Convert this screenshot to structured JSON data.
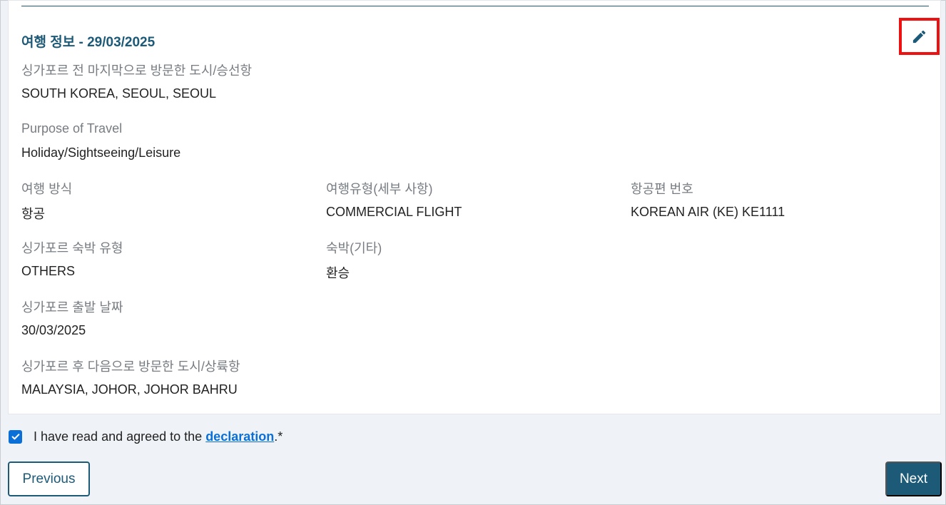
{
  "travel": {
    "title": "여행 정보 - 29/03/2025",
    "edit_icon": "pencil-icon",
    "last_city_label": "싱가포르 전 마지막으로 방문한 도시/승선항",
    "last_city_value": "SOUTH KOREA, SEOUL, SEOUL",
    "purpose_label": "Purpose of Travel",
    "purpose_value": "Holiday/Sightseeing/Leisure",
    "mode_label": "여행 방식",
    "mode_value": "항공",
    "type_label": "여행유형(세부 사항)",
    "type_value": "COMMERCIAL FLIGHT",
    "flight_label": "항공편 번호",
    "flight_value": "KOREAN AIR (KE) KE1111",
    "accom_type_label": "싱가포르 숙박 유형",
    "accom_type_value": "OTHERS",
    "accom_other_label": "숙박(기타)",
    "accom_other_value": "환승",
    "departure_label": "싱가포르 출발 날짜",
    "departure_value": "30/03/2025",
    "next_city_label": "싱가포르 후 다음으로 방문한 도시/상륙항",
    "next_city_value": "MALAYSIA, JOHOR, JOHOR BAHRU"
  },
  "declaration": {
    "checked": true,
    "text_before": "I have read and agreed to the ",
    "link_text": "declaration",
    "text_after": ".*"
  },
  "nav": {
    "previous_label": "Previous",
    "next_label": "Next"
  },
  "colors": {
    "primary": "#1c5a78",
    "link": "#0a6fd6",
    "highlight": "#ee1111"
  }
}
